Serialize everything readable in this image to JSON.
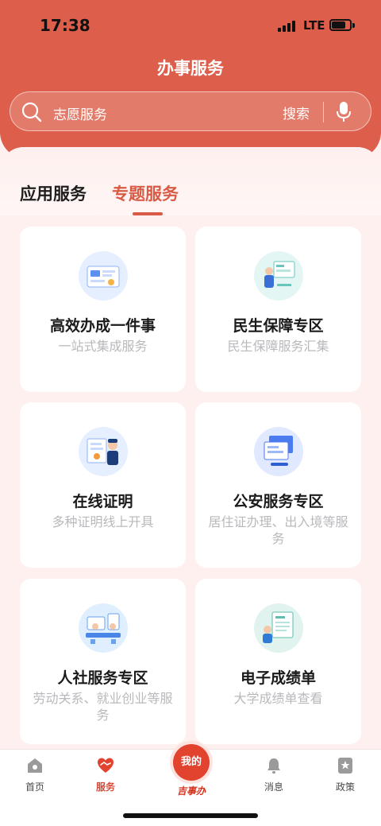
{
  "status_bar": {
    "time": "17:38",
    "network": "LTE"
  },
  "header": {
    "title": "办事服务"
  },
  "search": {
    "placeholder": "志愿服务",
    "button": "搜索"
  },
  "tabs": [
    {
      "label": "应用服务",
      "active": false
    },
    {
      "label": "专题服务",
      "active": true
    }
  ],
  "cards": [
    {
      "title": "高效办成一件事",
      "desc": "一站式集成服务",
      "icon": "dashboard-illustration-icon"
    },
    {
      "title": "民生保障专区",
      "desc": "民生保障服务汇集",
      "icon": "presentation-illustration-icon"
    },
    {
      "title": "在线证明",
      "desc": "多种证明线上开具",
      "icon": "officer-certificate-icon"
    },
    {
      "title": "公安服务专区",
      "desc": "居住证办理、出入境等服务",
      "icon": "screens-illustration-icon"
    },
    {
      "title": "人社服务专区",
      "desc": "劳动关系、就业创业等服务",
      "icon": "office-illustration-icon"
    },
    {
      "title": "电子成绩单",
      "desc": "大学成绩单查看",
      "icon": "transcript-illustration-icon"
    }
  ],
  "tabbar": {
    "home": "首页",
    "service": "服务",
    "mine": "我的",
    "mine_sub": "吉事办",
    "messages": "消息",
    "policy": "政策"
  },
  "colors": {
    "brand": "#dd5e4a",
    "accent_text": "#d95a45",
    "center_button": "#e2432f"
  }
}
